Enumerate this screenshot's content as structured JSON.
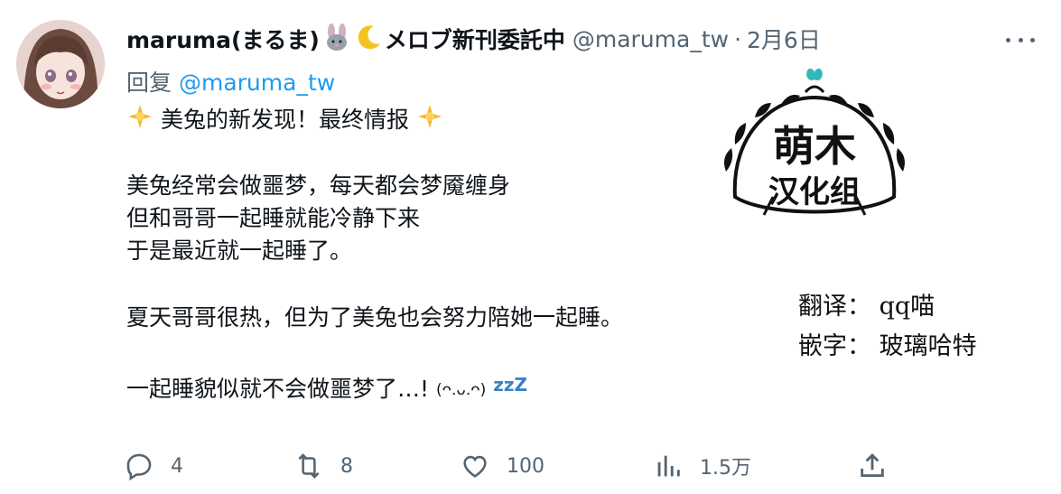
{
  "tweet": {
    "author": {
      "display_name": "maruma(まるま)",
      "name_suffix": "メロブ新刊委託中",
      "handle": "@maruma_tw",
      "separator": "·",
      "date": "2月6日",
      "emojis": [
        "rabbit-icon",
        "crescent-moon-icon"
      ]
    },
    "reply": {
      "prefix": "回复",
      "mention": "@maruma_tw"
    },
    "text": {
      "line1": "美兔的新发现！最终情报",
      "line2": "美兔经常会做噩梦，每天都会梦魇缠身",
      "line3": "但和哥哥一起睡就能冷静下来",
      "line4": "于是最近就一起睡了。",
      "line5": "夏天哥哥很热，但为了美兔也会努力陪她一起睡。",
      "line6": " 一起睡貌似就不会做噩梦了…!",
      "kaomoji": "(ᴖ.ᴗ.ᴖ)",
      "zzz": "zzZ"
    },
    "overlay": {
      "logo_line1": "萌木",
      "logo_line2": "汉化组",
      "translator": "翻译： qq喵",
      "typesetter": "嵌字： 玻璃哈特"
    },
    "actions": {
      "replies": "4",
      "retweets": "8",
      "likes": "100",
      "views": "1.5万"
    }
  },
  "colors": {
    "text": "#0f1419",
    "secondary": "#536471",
    "link": "#1d9bf0",
    "logo_accent": "#2fb9b8"
  }
}
